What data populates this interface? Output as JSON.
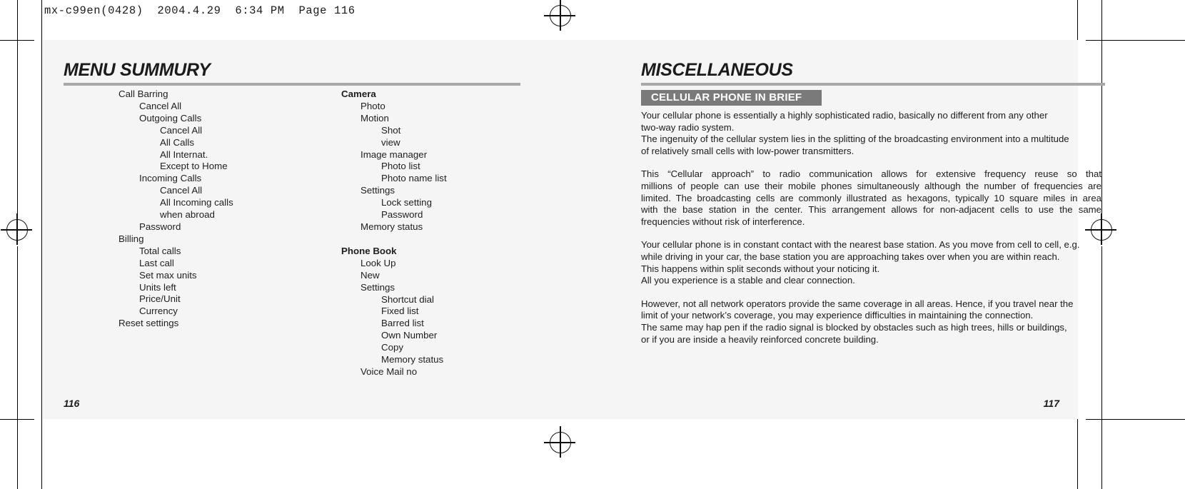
{
  "print_slug": "mx-c99en(0428)  2004.4.29  6:34 PM  Page 116",
  "left_page": {
    "chapter_title": "MENU SUMMURY",
    "folio": "116",
    "menu_column_1": [
      {
        "label": "Call Barring",
        "level": 0,
        "bold": false,
        "gap": false
      },
      {
        "label": "Cancel All",
        "level": 1,
        "bold": false,
        "gap": false
      },
      {
        "label": "Outgoing Calls",
        "level": 1,
        "bold": false,
        "gap": false
      },
      {
        "label": "Cancel All",
        "level": 2,
        "bold": false,
        "gap": false
      },
      {
        "label": "All Calls",
        "level": 2,
        "bold": false,
        "gap": false
      },
      {
        "label": "All Internat.",
        "level": 2,
        "bold": false,
        "gap": false
      },
      {
        "label": "Except to Home",
        "level": 2,
        "bold": false,
        "gap": false
      },
      {
        "label": "Incoming Calls",
        "level": 1,
        "bold": false,
        "gap": false
      },
      {
        "label": "Cancel All",
        "level": 2,
        "bold": false,
        "gap": false
      },
      {
        "label": "All Incoming calls",
        "level": 2,
        "bold": false,
        "gap": false
      },
      {
        "label": "when abroad",
        "level": 2,
        "bold": false,
        "gap": false
      },
      {
        "label": "Password",
        "level": 1,
        "bold": false,
        "gap": false
      },
      {
        "label": "Billing",
        "level": 0,
        "bold": false,
        "gap": false
      },
      {
        "label": "Total calls",
        "level": 1,
        "bold": false,
        "gap": false
      },
      {
        "label": "Last call",
        "level": 1,
        "bold": false,
        "gap": false
      },
      {
        "label": "Set max units",
        "level": 1,
        "bold": false,
        "gap": false
      },
      {
        "label": "Units left",
        "level": 1,
        "bold": false,
        "gap": false
      },
      {
        "label": "Price/Unit",
        "level": 1,
        "bold": false,
        "gap": false
      },
      {
        "label": "Currency",
        "level": 1,
        "bold": false,
        "gap": false
      },
      {
        "label": "Reset settings",
        "level": 0,
        "bold": false,
        "gap": false
      }
    ],
    "menu_column_2": [
      {
        "label": "Camera",
        "level": 0,
        "bold": true,
        "gap": false
      },
      {
        "label": "Photo",
        "level": 1,
        "bold": false,
        "gap": false
      },
      {
        "label": "Motion",
        "level": 1,
        "bold": false,
        "gap": false
      },
      {
        "label": "Shot",
        "level": 2,
        "bold": false,
        "gap": false
      },
      {
        "label": "view",
        "level": 2,
        "bold": false,
        "gap": false
      },
      {
        "label": "Image manager",
        "level": 1,
        "bold": false,
        "gap": false
      },
      {
        "label": "Photo list",
        "level": 2,
        "bold": false,
        "gap": false
      },
      {
        "label": "Photo name list",
        "level": 2,
        "bold": false,
        "gap": false
      },
      {
        "label": "Settings",
        "level": 1,
        "bold": false,
        "gap": false
      },
      {
        "label": "Lock setting",
        "level": 2,
        "bold": false,
        "gap": false
      },
      {
        "label": "Password",
        "level": 2,
        "bold": false,
        "gap": false
      },
      {
        "label": "Memory status",
        "level": 1,
        "bold": false,
        "gap": false
      },
      {
        "label": "Phone Book",
        "level": 0,
        "bold": true,
        "gap": true
      },
      {
        "label": "Look Up",
        "level": 1,
        "bold": false,
        "gap": false
      },
      {
        "label": "New",
        "level": 1,
        "bold": false,
        "gap": false
      },
      {
        "label": "Settings",
        "level": 1,
        "bold": false,
        "gap": false
      },
      {
        "label": "Shortcut dial",
        "level": 2,
        "bold": false,
        "gap": false
      },
      {
        "label": "Fixed list",
        "level": 2,
        "bold": false,
        "gap": false
      },
      {
        "label": "Barred list",
        "level": 2,
        "bold": false,
        "gap": false
      },
      {
        "label": "Own Number",
        "level": 2,
        "bold": false,
        "gap": false
      },
      {
        "label": "Copy",
        "level": 2,
        "bold": false,
        "gap": false
      },
      {
        "label": "Memory status",
        "level": 2,
        "bold": false,
        "gap": false
      },
      {
        "label": "Voice Mail no",
        "level": 1,
        "bold": false,
        "gap": false
      }
    ]
  },
  "right_page": {
    "chapter_title": "MISCELLANEOUS",
    "section_banner": "CELLULAR PHONE IN BRIEF",
    "folio": "117",
    "paragraphs": [
      {
        "justified": false,
        "spaced": false,
        "lines": [
          "Your cellular phone is essentially a highly sophisticated radio, basically no different from any other",
          "two-way radio system.",
          "The ingenuity of the cellular system lies in the splitting of the broadcasting environment into a multitude",
          "of relatively small cells with low-power transmitters."
        ]
      },
      {
        "justified": true,
        "spaced": true,
        "lines": [
          "This “Cellular approach” to radio communication allows for extensive frequency reuse so that",
          "millions of people can use their mobile phones simultaneously although the number of frequencies are",
          "limited. The broadcasting cells are commonly illustrated as hexagons, typically 10 square miles in area",
          "with the base station in the center. This arrangement allows for non-adjacent cells to use the same",
          "frequencies without risk of interference."
        ]
      },
      {
        "justified": false,
        "spaced": true,
        "lines": [
          "Your cellular phone is in constant contact with the nearest base station. As you move from cell to cell, e.g.",
          "while driving in your car, the base station you are approaching takes over when you are within reach.",
          "This happens within split seconds without your noticing it.",
          "All you experience is a stable and clear connection."
        ]
      },
      {
        "justified": false,
        "spaced": true,
        "lines": [
          "However, not all network operators provide the same coverage in all areas. Hence, if you travel near the",
          "limit of your network’s coverage, you may experience difficulties in maintaining the connection.",
          "The same may hap pen if the radio signal is blocked by obstacles such as high trees, hills or buildings,",
          "or if you are inside a heavily reinforced concrete building."
        ]
      }
    ]
  },
  "colors": {
    "page_background": "#f5f5f5",
    "banner_background": "#7a7a7a",
    "rule": "#a8a8a8",
    "text": "#1c1c1c"
  }
}
